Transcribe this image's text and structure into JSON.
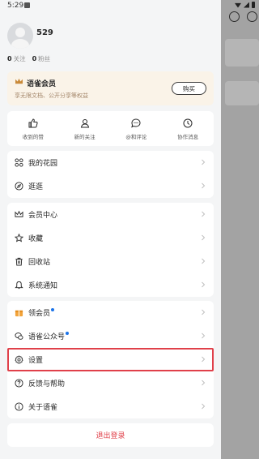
{
  "status_bar": {
    "time": "5:29"
  },
  "profile": {
    "username": "529",
    "following_count": "0",
    "following_label": "关注",
    "followers_count": "0",
    "followers_label": "粉丝"
  },
  "vip": {
    "title": "语雀会员",
    "subtitle": "享无限文档、公开分享等权益",
    "buy_label": "购买"
  },
  "quick_actions": [
    {
      "label": "收到的赞",
      "icon": "thumbs-up-icon"
    },
    {
      "label": "新的关注",
      "icon": "user-icon"
    },
    {
      "label": "@和评论",
      "icon": "comment-icon"
    },
    {
      "label": "协作消息",
      "icon": "clock-icon"
    }
  ],
  "group1": [
    {
      "label": "我的花园",
      "icon": "garden-icon"
    },
    {
      "label": "逛逛",
      "icon": "compass-icon"
    }
  ],
  "group2": [
    {
      "label": "会员中心",
      "icon": "crown-icon"
    },
    {
      "label": "收藏",
      "icon": "star-icon"
    },
    {
      "label": "回收站",
      "icon": "trash-icon"
    },
    {
      "label": "系统通知",
      "icon": "bell-icon"
    }
  ],
  "group3": [
    {
      "label": "领会员",
      "icon": "gift-icon"
    },
    {
      "label": "语雀公众号",
      "icon": "wechat-icon"
    },
    {
      "label": "设置",
      "icon": "gear-icon"
    },
    {
      "label": "反馈与帮助",
      "icon": "help-icon"
    },
    {
      "label": "关于语雀",
      "icon": "info-icon"
    }
  ],
  "logout_label": "退出登录",
  "colors": {
    "accent_red": "#e0404a",
    "notification_dot": "#1a73e8",
    "vip_bg": "#faf3e8"
  }
}
